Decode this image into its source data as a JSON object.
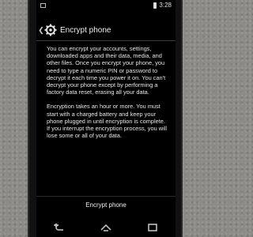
{
  "status_bar": {
    "time": "3:28",
    "icons": [
      "notification-icon",
      "battery-icon"
    ]
  },
  "action_bar": {
    "title": "Encrypt phone",
    "icons": [
      "back-caret-icon",
      "gear-icon"
    ]
  },
  "body": {
    "paragraph_1": "You can encrypt your accounts, settings, downloaded apps and their data, media, and other files. Once you encrypt your phone, you need to type a numeric PIN or password to decrypt it each time you power it on. You can't decrypt your phone except by performing a factory data reset, erasing all your data.",
    "paragraph_2": "Encryption takes an hour or more. You must start with a charged battery and keep your phone plugged in until encryption is complete. If you interrupt the encryption process, you will lose some or all of your data."
  },
  "button": {
    "label": "Encrypt phone"
  },
  "nav_bar": {
    "icons": [
      "back-icon",
      "home-icon",
      "recents-icon"
    ]
  }
}
